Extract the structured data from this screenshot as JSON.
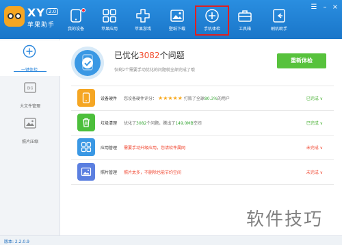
{
  "app": {
    "name": "XY",
    "version_badge": "2.0",
    "subtitle": "苹果助手"
  },
  "nav": {
    "items": [
      {
        "label": "我的设备",
        "icon": "device-icon",
        "has_dot": true
      },
      {
        "label": "苹果应用",
        "icon": "apps-icon"
      },
      {
        "label": "苹果游戏",
        "icon": "game-icon"
      },
      {
        "label": "壁纸下载",
        "icon": "wallpaper-icon"
      },
      {
        "label": "手机体检",
        "icon": "checkup-icon",
        "active": true
      },
      {
        "label": "工具箱",
        "icon": "toolbox-icon"
      },
      {
        "label": "刷机助手",
        "icon": "flash-icon"
      }
    ]
  },
  "sidebar": {
    "items": [
      {
        "label": "一键体检",
        "icon": "plus-circle-icon",
        "active": true
      },
      {
        "label": "大文件管理",
        "icon": "big-file-icon"
      },
      {
        "label": "照片压缩",
        "icon": "photo-compress-icon"
      }
    ]
  },
  "hero": {
    "title_prefix": "已优化",
    "count": "3082",
    "title_suffix": "个问题",
    "description": "仅剩2个需要手动优化的问题就全部完成了哦",
    "button_label": "重新体检"
  },
  "rows": [
    {
      "title": "设备硬件",
      "desc_prefix": "您设备硬件评分：",
      "stars": "★★★★★",
      "desc_mid": "打败了全球",
      "desc_highlight": "80.3%",
      "desc_suffix": "的用户",
      "status": "已完成 ∨",
      "color": "#f5a623"
    },
    {
      "title": "垃圾清理",
      "desc_prefix": "优化了",
      "desc_count": "3082",
      "desc_mid": "个问题，腾出了",
      "desc_highlight": "149.0MB",
      "desc_suffix": "空间",
      "status": "已完成 ∨",
      "color": "#4cbf3b"
    },
    {
      "title": "应用管理",
      "desc": "需要手动升级应用，您请软件属网",
      "status": "未完成 ∨",
      "color": "#3a98e4"
    },
    {
      "title": "照片管理",
      "desc": "照片太多，不删除也能节约空间",
      "status": "未完成 ∨",
      "color": "#5b7fe0"
    }
  ],
  "statusbar": {
    "version": "版本: 2.2.0.9"
  },
  "watermark": "软件技巧"
}
